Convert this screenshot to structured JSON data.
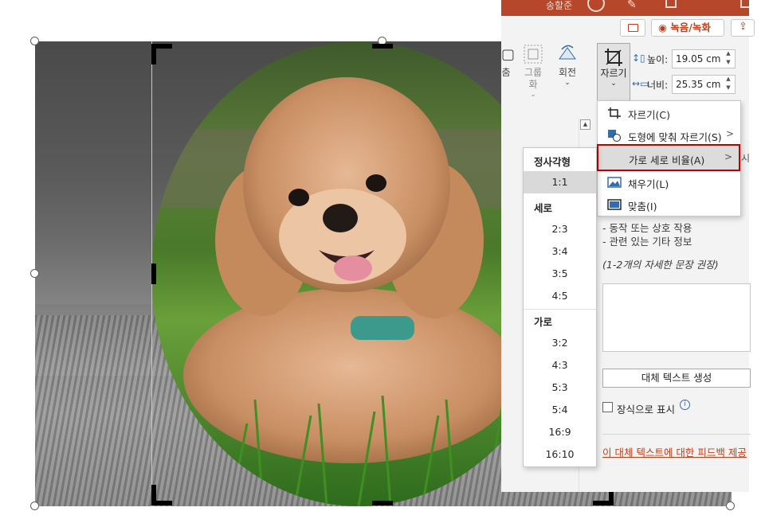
{
  "window": {
    "user_name": "송할준"
  },
  "ribbon": {
    "record_label": "녹음/녹화",
    "move_label": "춤",
    "group_label": "그룹화",
    "group_chevron": "⌄",
    "rotate_label": "회전",
    "rotate_chevron": "⌄",
    "crop_label": "자르기",
    "crop_chevron": "⌄",
    "height_label": "높이:",
    "height_value": "19.05 cm",
    "width_label": "너비:",
    "width_value": "25.35 cm"
  },
  "crop_menu": {
    "items": [
      {
        "label": "자르기(C)",
        "icon": "crop-icon"
      },
      {
        "label": "도형에 맞춰 자르기(S)",
        "icon": "crop-to-shape-icon",
        "has_submenu": true
      },
      {
        "label": "가로 세로 비율(A)",
        "icon": "",
        "has_submenu": true
      },
      {
        "label": "채우기(L)",
        "icon": "fill-icon"
      },
      {
        "label": "맞춤(I)",
        "icon": "fit-icon"
      }
    ]
  },
  "ratio_menu": {
    "groups": [
      {
        "header": "정사각형",
        "items": [
          "1:1"
        ]
      },
      {
        "header": "세로",
        "items": [
          "2:3",
          "3:4",
          "3:5",
          "4:5"
        ]
      },
      {
        "header": "가로",
        "items": [
          "3:2",
          "4:3",
          "5:3",
          "5:4",
          "16:9",
          "16:10"
        ]
      }
    ],
    "selected": "1:1"
  },
  "alt_text_pane": {
    "bullet_1": "- 동작 또는 상호 작용",
    "bullet_2": "- 관련 있는 기타 정보",
    "hint": "(1-2개의 자세한 문장 권장)",
    "generate_button": "대체 텍스트 생성",
    "decorative_label": "장식으로 표시",
    "feedback_link": "이 대체 텍스트에 대한 피드백 제공",
    "cut_text": "시"
  },
  "colors": {
    "accent": "#b7472a",
    "record": "#c43e1c",
    "highlight_border": "#c00000"
  }
}
